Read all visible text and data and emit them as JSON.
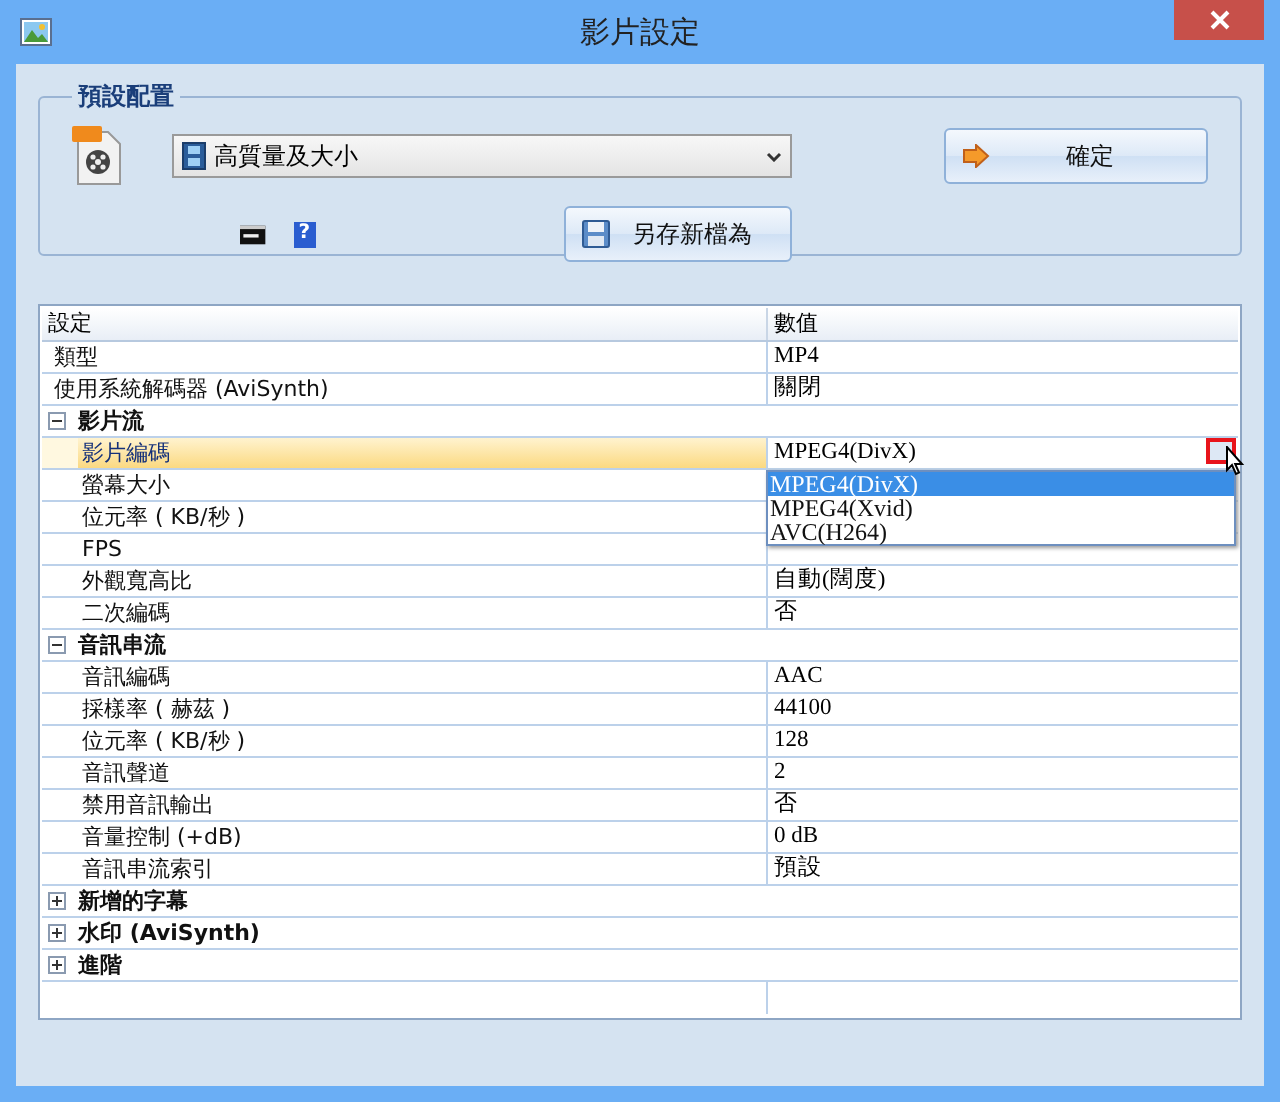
{
  "window": {
    "title": "影片設定"
  },
  "preset_group": {
    "title": "預設配置",
    "profile": "高質量及大小",
    "ok_button": "確定",
    "save_as_button": "另存新檔為",
    "help_icon": "?"
  },
  "grid": {
    "columns": [
      "設定",
      "數值"
    ],
    "rows": [
      {
        "kind": "property",
        "name": "類型",
        "value": "MP4",
        "selected": false
      },
      {
        "kind": "property",
        "name": "使用系統解碼器 (AviSynth)",
        "value": "關閉",
        "selected": false
      },
      {
        "kind": "category",
        "name": "影片流",
        "expanded": true,
        "children": [
          {
            "kind": "property",
            "name": "影片編碼",
            "value": "MPEG4(DivX)",
            "selected": true,
            "dropdown": {
              "options": [
                {
                  "label": "MPEG4(DivX)",
                  "selected": true
                },
                {
                  "label": "MPEG4(Xvid)",
                  "selected": false
                },
                {
                  "label": "AVC(H264)",
                  "selected": false
                }
              ]
            }
          },
          {
            "kind": "property",
            "name": "螢幕大小",
            "selected": false
          },
          {
            "kind": "property",
            "name": "位元率 ( KB/秒 )",
            "selected": false
          },
          {
            "kind": "property",
            "name": "FPS",
            "selected": false
          },
          {
            "kind": "property",
            "name": "外觀寬高比",
            "value": "自動(闊度)",
            "selected": false
          },
          {
            "kind": "property",
            "name": "二次編碼",
            "value": "否",
            "selected": false
          }
        ]
      },
      {
        "kind": "category",
        "name": "音訊串流",
        "expanded": true,
        "children": [
          {
            "kind": "property",
            "name": "音訊編碼",
            "value": "AAC",
            "selected": false
          },
          {
            "kind": "property",
            "name": "採樣率 ( 赫茲 )",
            "value": "44100",
            "selected": false
          },
          {
            "kind": "property",
            "name": "位元率 ( KB/秒 )",
            "value": "128",
            "selected": false
          },
          {
            "kind": "property",
            "name": "音訊聲道",
            "value": "2",
            "selected": false
          },
          {
            "kind": "property",
            "name": "禁用音訊輸出",
            "value": "否",
            "selected": false
          },
          {
            "kind": "property",
            "name": "音量控制 (+dB)",
            "value": "0 dB",
            "selected": false
          },
          {
            "kind": "property",
            "name": "音訊串流索引",
            "value": "預設",
            "selected": false
          }
        ]
      },
      {
        "kind": "category",
        "name": "新增的字幕",
        "expanded": false
      },
      {
        "kind": "category",
        "name": "水印 (AviSynth)",
        "expanded": false
      },
      {
        "kind": "category",
        "name": "進階",
        "expanded": false
      }
    ]
  }
}
